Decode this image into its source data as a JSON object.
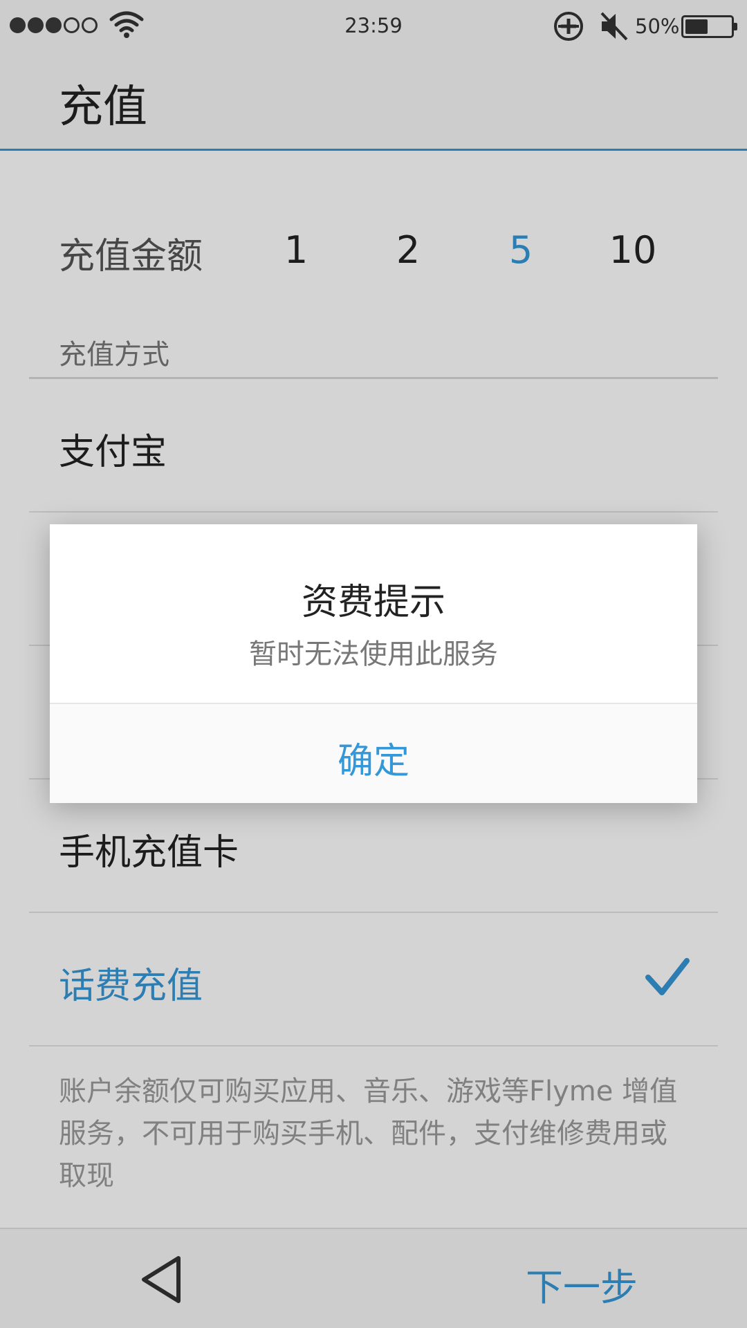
{
  "status_bar": {
    "time": "23:59",
    "battery_percent": "50%",
    "battery_level": 0.5,
    "signal_strength": 3,
    "signal_max": 5
  },
  "header": {
    "title": "充值"
  },
  "amount": {
    "label": "充值金额",
    "options": [
      "1",
      "2",
      "5",
      "10"
    ],
    "selected": "5"
  },
  "payment": {
    "section_label": "充值方式",
    "methods": [
      {
        "label": "支付宝",
        "selected": false
      },
      {
        "label": "",
        "selected": false
      },
      {
        "label": "",
        "selected": false
      },
      {
        "label": "手机充值卡",
        "selected": false
      },
      {
        "label": "话费充值",
        "selected": true
      }
    ]
  },
  "disclaimer": "账户余额仅可购买应用、音乐、游戏等Flyme 增值服务，不可用于购买手机、配件，支付维修费用或取现",
  "bottom_bar": {
    "next_label": "下一步"
  },
  "dialog": {
    "title": "资费提示",
    "message": "暂时无法使用此服务",
    "confirm_label": "确定"
  },
  "colors": {
    "accent": "#3497d7",
    "text_primary": "#222222",
    "text_secondary": "#777777",
    "bar_background": "#f7f7f7"
  },
  "icons": [
    "wifi-icon",
    "sync-icon",
    "mute-icon",
    "battery-icon",
    "check-icon",
    "back-icon"
  ]
}
